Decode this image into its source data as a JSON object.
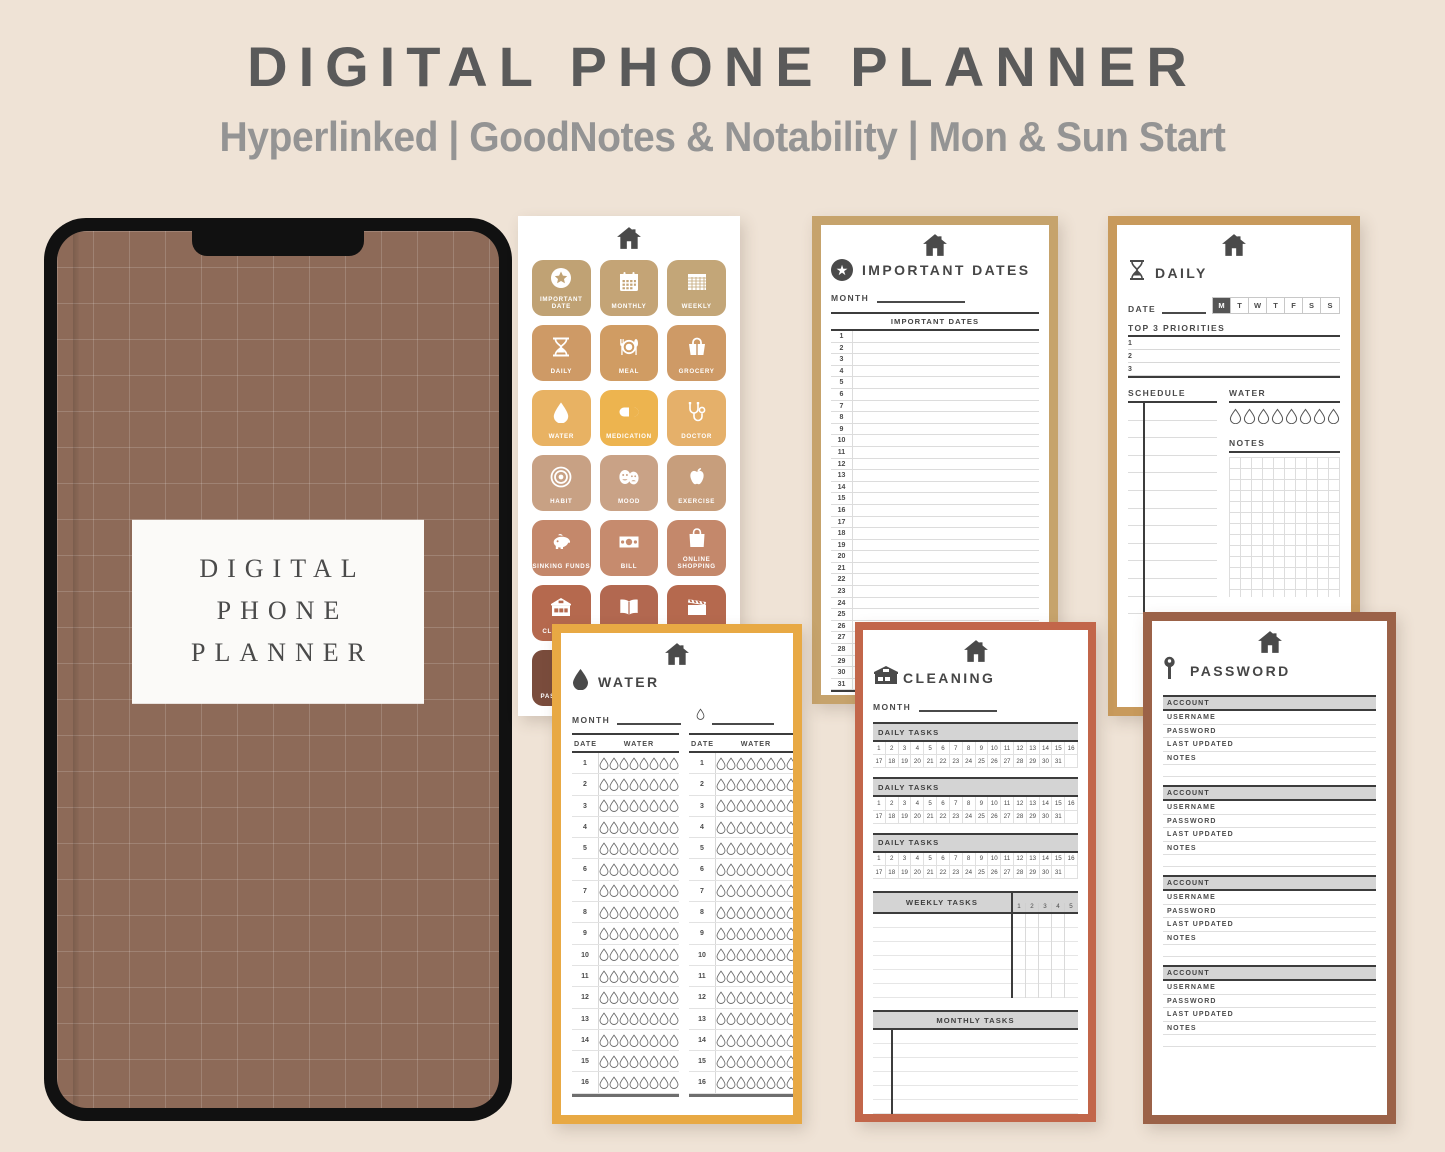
{
  "header": {
    "title": "DIGITAL PHONE PLANNER",
    "subtitle": "Hyperlinked | GoodNotes & Notability | Mon & Sun Start"
  },
  "colors": {
    "page_background": "#EFE3D6",
    "phone_frame": "#111111",
    "cover_brown": "#8D6A58",
    "border_icons": "#FFFFFF",
    "border_dates": "#C6A36C",
    "border_daily": "#C89A5C",
    "border_water": "#E8A944",
    "border_cleaning": "#C2664A",
    "border_password": "#9B6248",
    "ink": "#4A4A4A"
  },
  "phone": {
    "cover_lines": [
      "DIGITAL",
      "PHONE",
      "PLANNER"
    ]
  },
  "icon_page": {
    "home_icon": "home-icon",
    "tiles": [
      {
        "label": "IMPORTANT DATE",
        "icon": "star-icon",
        "color": "#C0A274"
      },
      {
        "label": "MONTHLY",
        "icon": "calendar-month-icon",
        "color": "#C4A476"
      },
      {
        "label": "WEEKLY",
        "icon": "calendar-week-icon",
        "color": "#C3A678"
      },
      {
        "label": "DAILY",
        "icon": "hourglass-icon",
        "color": "#CE9A66"
      },
      {
        "label": "MEAL",
        "icon": "plate-cutlery-icon",
        "color": "#D09C63"
      },
      {
        "label": "GROCERY",
        "icon": "basket-icon",
        "color": "#CE9A66"
      },
      {
        "label": "WATER",
        "icon": "water-drop-icon",
        "color": "#E8B263"
      },
      {
        "label": "MEDICATION",
        "icon": "pill-icon",
        "color": "#EDB44F"
      },
      {
        "label": "DOCTOR",
        "icon": "stethoscope-icon",
        "color": "#E5B06A"
      },
      {
        "label": "HABIT",
        "icon": "target-icon",
        "color": "#C8A184"
      },
      {
        "label": "MOOD",
        "icon": "theatre-masks-icon",
        "color": "#C9A286"
      },
      {
        "label": "EXERCISE",
        "icon": "apple-icon",
        "color": "#C79E7C"
      },
      {
        "label": "SINKING FUNDS",
        "icon": "piggy-bank-icon",
        "color": "#C4886B"
      },
      {
        "label": "BILL",
        "icon": "banknote-icon",
        "color": "#C68B6E"
      },
      {
        "label": "ONLINE SHOPPING",
        "icon": "shopping-bag-icon",
        "color": "#C4886B"
      },
      {
        "label": "CLEANING",
        "icon": "house-front-icon",
        "color": "#B5694E"
      },
      {
        "label": "READING",
        "icon": "open-book-icon",
        "color": "#B26850"
      },
      {
        "label": "MOVIE",
        "icon": "clapperboard-icon",
        "color": "#B5694E"
      },
      {
        "label": "PASSWORD",
        "icon": "key-icon",
        "color": "#7A4C3C"
      },
      {
        "label": "",
        "icon": "",
        "color": "#7A4C3C"
      },
      {
        "label": "",
        "icon": "",
        "color": "#7A4C3C"
      }
    ]
  },
  "important_dates_page": {
    "home_icon": "home-icon",
    "badge_icon": "star-icon",
    "title": "IMPORTANT DATES",
    "month_label": "MONTH",
    "table_header": "IMPORTANT DATES",
    "rows": [
      "1",
      "2",
      "3",
      "4",
      "5",
      "6",
      "7",
      "8",
      "9",
      "10",
      "11",
      "12",
      "13",
      "14",
      "15",
      "16",
      "17",
      "18",
      "19",
      "20",
      "21",
      "22",
      "23",
      "24",
      "25",
      "26",
      "27",
      "28",
      "29",
      "30",
      "31"
    ]
  },
  "daily_page": {
    "home_icon": "home-icon",
    "badge_icon": "hourglass-icon",
    "title": "DAILY",
    "date_label": "DATE",
    "weekdays": [
      "M",
      "T",
      "W",
      "T",
      "F",
      "S",
      "S"
    ],
    "weekday_selected": "M",
    "priorities_label": "TOP 3 PRIORITIES",
    "priorities": [
      "1",
      "2",
      "3"
    ],
    "schedule_label": "SCHEDULE",
    "water_label": "WATER",
    "water_cups": 8,
    "notes_label": "NOTES"
  },
  "water_page": {
    "home_icon": "home-icon",
    "badge_icon": "water-drop-icon",
    "title": "WATER",
    "month_label": "MONTH",
    "goal_icon": "water-drop-icon",
    "col_date": "DATE",
    "col_water": "WATER",
    "drops_per_row": 8,
    "left_rows": [
      "1",
      "2",
      "3",
      "4",
      "5",
      "6",
      "7",
      "8",
      "9",
      "10",
      "11",
      "12",
      "13",
      "14",
      "15",
      "16"
    ],
    "right_rows": [
      "1",
      "2",
      "3",
      "4",
      "5",
      "6",
      "7",
      "8",
      "9",
      "10",
      "11",
      "12",
      "13",
      "14",
      "15",
      "16"
    ]
  },
  "cleaning_page": {
    "home_icon": "home-icon",
    "badge_icon": "house-front-icon",
    "title": "CLEANING",
    "month_label": "MONTH",
    "daily_sections": [
      "DAILY TASKS",
      "DAILY TASKS",
      "DAILY TASKS"
    ],
    "day_numbers": [
      "1",
      "2",
      "3",
      "4",
      "5",
      "6",
      "7",
      "8",
      "9",
      "10",
      "11",
      "12",
      "13",
      "14",
      "15",
      "16",
      "17",
      "18",
      "19",
      "20",
      "21",
      "22",
      "23",
      "24",
      "25",
      "26",
      "27",
      "28",
      "29",
      "30",
      "31",
      ""
    ],
    "weekly_label": "WEEKLY TASKS",
    "weekly_columns": [
      "1",
      "2",
      "3",
      "4",
      "5"
    ],
    "monthly_label": "MONTHLY TASKS"
  },
  "password_page": {
    "home_icon": "home-icon",
    "badge_icon": "key-icon",
    "title": "PASSWORD",
    "block_count": 4,
    "fields": [
      "USERNAME",
      "PASSWORD",
      "LAST UPDATED",
      "NOTES"
    ],
    "account_label": "ACCOUNT"
  }
}
